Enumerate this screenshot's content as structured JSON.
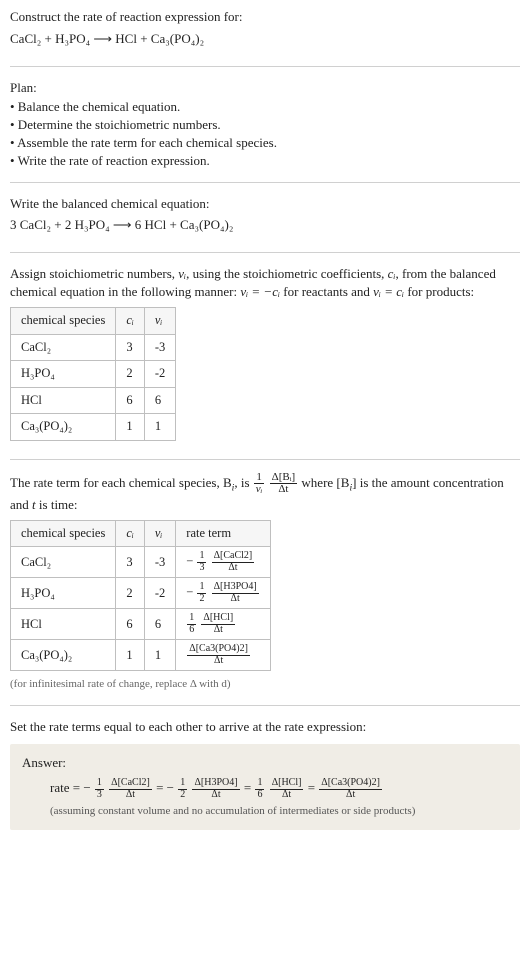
{
  "header": {
    "prompt": "Construct the rate of reaction expression for:",
    "equation": "CaCl₂ + H₃PO₄  ⟶  HCl + Ca₃(PO₄)₂"
  },
  "plan": {
    "title": "Plan:",
    "items": [
      "• Balance the chemical equation.",
      "• Determine the stoichiometric numbers.",
      "• Assemble the rate term for each chemical species.",
      "• Write the rate of reaction expression."
    ]
  },
  "balanced": {
    "title": "Write the balanced chemical equation:",
    "equation": "3 CaCl₂ + 2 H₃PO₄  ⟶  6 HCl + Ca₃(PO₄)₂"
  },
  "stoich": {
    "intro_a": "Assign stoichiometric numbers, ",
    "intro_b": ", using the stoichiometric coefficients, ",
    "intro_c": ", from the balanced chemical equation in the following manner: ",
    "intro_d": " for reactants and ",
    "intro_e": " for products:",
    "headers": [
      "chemical species",
      "cᵢ",
      "νᵢ"
    ],
    "rows": [
      {
        "species": "CaCl₂",
        "c": "3",
        "v": "-3"
      },
      {
        "species": "H₃PO₄",
        "c": "2",
        "v": "-2"
      },
      {
        "species": "HCl",
        "c": "6",
        "v": "6"
      },
      {
        "species": "Ca₃(PO₄)₂",
        "c": "1",
        "v": "1"
      }
    ]
  },
  "rateterm": {
    "intro_a": "The rate term for each chemical species, B",
    "intro_b": ", is ",
    "intro_c": " where [B",
    "intro_d": "] is the amount concentration and ",
    "intro_e": " is time:",
    "headers": [
      "chemical species",
      "cᵢ",
      "νᵢ",
      "rate term"
    ],
    "rows": [
      {
        "species": "CaCl₂",
        "c": "3",
        "v": "-3",
        "rprefix": "−",
        "rnum": "1",
        "rden": "3",
        "dnum": "Δ[CaCl2]",
        "dden": "Δt"
      },
      {
        "species": "H₃PO₄",
        "c": "2",
        "v": "-2",
        "rprefix": "−",
        "rnum": "1",
        "rden": "2",
        "dnum": "Δ[H3PO4]",
        "dden": "Δt"
      },
      {
        "species": "HCl",
        "c": "6",
        "v": "6",
        "rprefix": "",
        "rnum": "1",
        "rden": "6",
        "dnum": "Δ[HCl]",
        "dden": "Δt"
      },
      {
        "species": "Ca₃(PO₄)₂",
        "c": "1",
        "v": "1",
        "rprefix": "",
        "rnum": "",
        "rden": "",
        "dnum": "Δ[Ca3(PO4)2]",
        "dden": "Δt"
      }
    ],
    "note": "(for infinitesimal rate of change, replace Δ with d)"
  },
  "final": {
    "title": "Set the rate terms equal to each other to arrive at the rate expression:",
    "answer_label": "Answer:",
    "rate_lead": "rate = −",
    "t1_num": "1",
    "t1_den": "3",
    "t1_dnum": "Δ[CaCl2]",
    "t1_dden": "Δt",
    "eq1": " = −",
    "t2_num": "1",
    "t2_den": "2",
    "t2_dnum": "Δ[H3PO4]",
    "t2_dden": "Δt",
    "eq2": " = ",
    "t3_num": "1",
    "t3_den": "6",
    "t3_dnum": "Δ[HCl]",
    "t3_dden": "Δt",
    "eq3": " = ",
    "t4_dnum": "Δ[Ca3(PO4)2]",
    "t4_dden": "Δt",
    "note": "(assuming constant volume and no accumulation of intermediates or side products)"
  },
  "sym": {
    "nu_i": "νᵢ",
    "c_i": "cᵢ",
    "nu_eq_neg_c": "νᵢ = −cᵢ",
    "nu_eq_c": "νᵢ = cᵢ",
    "i": "i",
    "t": "t",
    "one": "1",
    "dBi": "Δ[Bᵢ]",
    "dt": "Δt"
  }
}
